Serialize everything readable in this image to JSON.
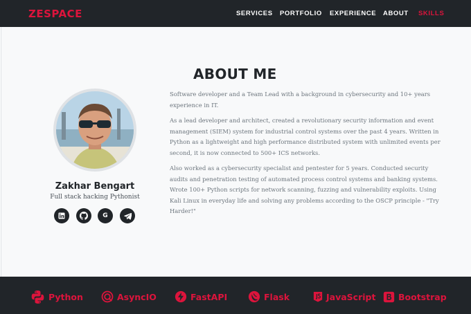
{
  "brand": {
    "logo": "ZESPACE",
    "accent": "#dc143c"
  },
  "nav": {
    "items": [
      {
        "label": "SERVICES",
        "active": false
      },
      {
        "label": "PORTFOLIO",
        "active": false
      },
      {
        "label": "EXPERIENCE",
        "active": false
      },
      {
        "label": "ABOUT",
        "active": false
      },
      {
        "label": "SKILLS",
        "active": true
      }
    ]
  },
  "profile": {
    "name": "Zakhar Bengart",
    "tagline": "Full stack hacking Pythonist",
    "socials": [
      {
        "icon": "linkedin-icon",
        "glyph": "in"
      },
      {
        "icon": "github-icon",
        "glyph": ""
      },
      {
        "icon": "google-icon",
        "glyph": "G"
      },
      {
        "icon": "telegram-icon",
        "glyph": ""
      }
    ]
  },
  "about": {
    "title": "ABOUT ME",
    "paragraphs": [
      "Software developer and a Team Lead with a background in cybersecurity and 10+ years experience in IT.",
      "As a lead developer and architect, created a revolutionary security information and event management (SIEM) system for industrial control systems over the past 4 years. Written in Python as a lightweight and high performance distributed system with unlimited events per second, it is now connected to 500+ ICS networks.",
      "Also worked as a cybersecurity specialist and pentester for 5 years. Conducted security audits and penetration testing of automated process control systems and banking systems. Wrote 100+ Python scripts for network scanning, fuzzing and vulnerability exploits. Using Kali Linux in everyday life and solving any problems according to the OSCP principle - \"Try Harder!\""
    ]
  },
  "skills": [
    {
      "label": "Python",
      "icon": "python-icon"
    },
    {
      "label": "AsyncIO",
      "icon": "asyncio-icon"
    },
    {
      "label": "FastAPI",
      "icon": "fastapi-icon"
    },
    {
      "label": "Flask",
      "icon": "flask-icon"
    },
    {
      "label": "JavaScript",
      "icon": "javascript-icon"
    },
    {
      "label": "Bootstrap",
      "icon": "bootstrap-icon"
    }
  ]
}
